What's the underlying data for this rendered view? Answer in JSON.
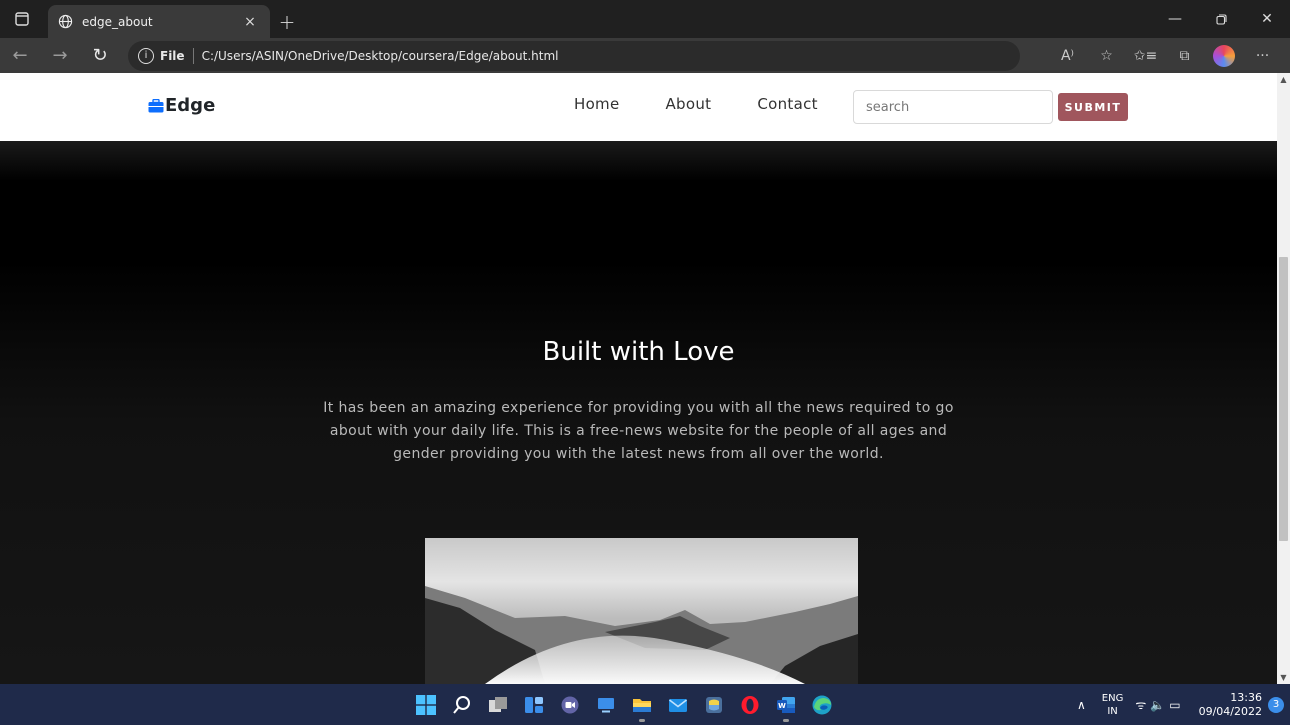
{
  "browser": {
    "tab_title": "edge_about",
    "tab_close": "×",
    "new_tab": "+",
    "address_label": "File",
    "url": "C:/Users/ASIN/OneDrive/Desktop/coursera/Edge/about.html",
    "icons": [
      "tab-actions-icon",
      "globe-icon",
      "back-icon",
      "forward-icon",
      "refresh-icon",
      "info-icon",
      "read-aloud-icon",
      "add-favorite-icon",
      "favorites-icon",
      "collections-icon",
      "profile-icon",
      "more-icon",
      "minimize-icon",
      "restore-icon",
      "close-icon"
    ]
  },
  "site": {
    "brand": "Edge",
    "nav": {
      "home": "Home",
      "about": "About",
      "contact": "Contact"
    },
    "search_placeholder": "search",
    "submit_label": "SUBMIT",
    "accent_color": "#a0565d"
  },
  "hero": {
    "title": "Built with Love",
    "text": "It has been an amazing experience for providing you with all the news required to go about with your daily life. This is a free-news website for the people of all ages and gender providing you with the latest news from all over the world."
  },
  "taskbar": {
    "apps": [
      "windows-start-icon",
      "search-icon",
      "task-view-icon",
      "widgets-icon",
      "teams-chat-icon",
      "desktop-icon",
      "file-explorer-icon",
      "mail-icon",
      "python-icon",
      "opera-icon",
      "word-icon",
      "edge-icon"
    ],
    "lang_top": "ENG",
    "lang_bottom": "IN",
    "time": "13:36",
    "date": "09/04/2022",
    "notifications": "3"
  }
}
